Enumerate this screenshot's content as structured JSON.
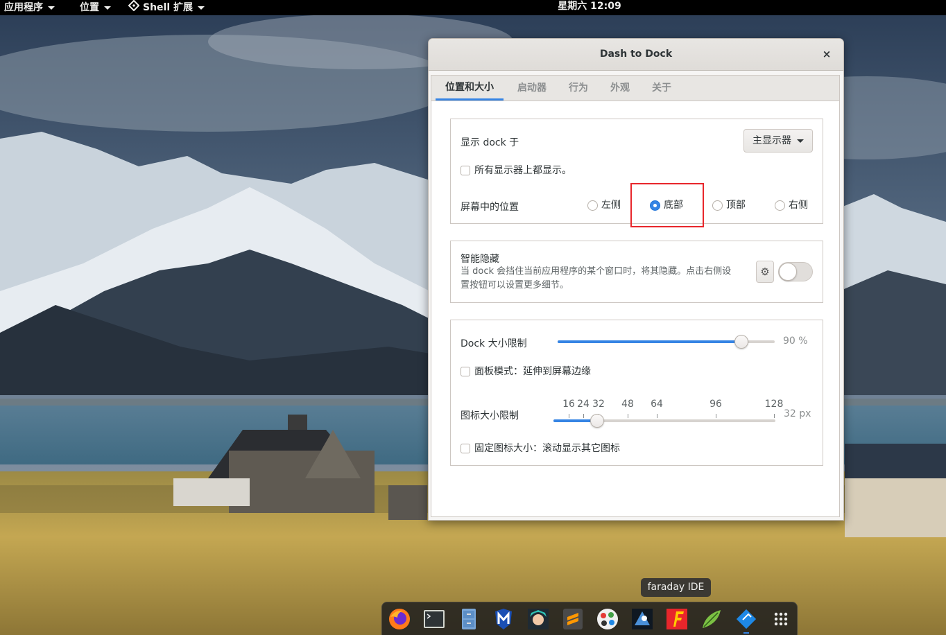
{
  "topbar": {
    "apps_menu": "应用程序",
    "places_menu": "位置",
    "shell_ext_menu": "Shell 扩展",
    "clock": "星期六 12:09"
  },
  "dialog": {
    "title": "Dash to Dock",
    "close_symbol": "×",
    "tabs": [
      "位置和大小",
      "启动器",
      "行为",
      "外观",
      "关于"
    ],
    "position": {
      "show_dock_on_label": "显示 dock 于",
      "monitor_value": "主显示器",
      "all_monitors_label": "所有显示器上都显示。",
      "all_monitors_checked": false,
      "screen_position_label": "屏幕中的位置",
      "options": [
        "左侧",
        "底部",
        "顶部",
        "右侧"
      ],
      "selected": "底部"
    },
    "autohide": {
      "title": "智能隐藏",
      "description": "当 dock 会挡住当前应用程序的某个窗口时，将其隐藏。点击右侧设置按钮可以设置更多细节。",
      "enabled": false
    },
    "size": {
      "dock_size_label": "Dock 大小限制",
      "dock_size_value": "90 %",
      "dock_size_fraction": 0.9,
      "panel_mode_label": "面板模式：延伸到屏幕边缘",
      "panel_mode_checked": false,
      "icon_size_label": "图标大小限制",
      "icon_size_marks": [
        "16",
        "24",
        "32",
        "48",
        "64",
        "96",
        "128"
      ],
      "icon_size_value": "32 px",
      "fixed_icon_label": "固定图标大小：滚动显示其它图标",
      "fixed_icon_checked": false
    }
  },
  "dock": {
    "tooltip": "faraday IDE",
    "items": [
      "firefox-icon",
      "terminal-icon",
      "file-cabinet-icon",
      "malwarebytes-icon",
      "anime-avatar-icon",
      "sublime-icon",
      "palette-icon",
      "inkscape-icon",
      "faraday-icon",
      "feather-icon",
      "diamond-app-icon",
      "app-grid-icon"
    ],
    "accent": "#3584e4"
  }
}
